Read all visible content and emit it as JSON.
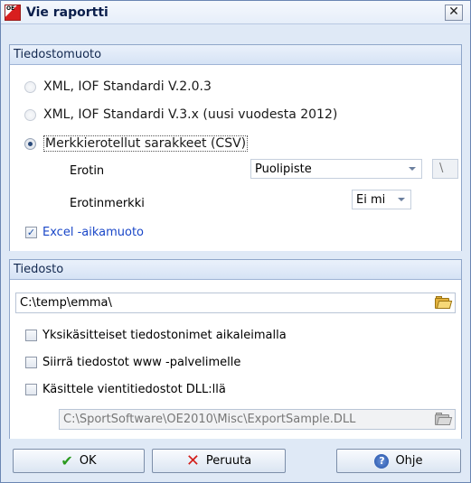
{
  "window": {
    "title": "Vie raportti",
    "app_icon_text": "OE",
    "close_label": "✕"
  },
  "format_group": {
    "header": "Tiedostomuoto",
    "options": [
      {
        "label": "XML, IOF Standardi V.2.0.3",
        "checked": false
      },
      {
        "label": "XML, IOF Standardi V.3.x (uusi vuodesta 2012)",
        "checked": false
      },
      {
        "label": "Merkkierotellut sarakkeet (CSV)",
        "checked": true
      }
    ],
    "separator_label": "Erotin",
    "separator_value": "Puolipiste",
    "separator_char": "\\",
    "text_marker_label": "Erotinmerkki",
    "text_marker_value": "Ei mi",
    "excel_time_label": "Excel -aikamuoto",
    "excel_time_checked": true
  },
  "file_group": {
    "header": "Tiedosto",
    "path": "C:\\temp\\emma\\",
    "unique_names_label": "Yksikäsitteiset tiedostonimet aikaleimalla",
    "upload_label": "Siirrä tiedostot www -palvelimelle",
    "dll_label": "Käsittele vientitiedostot DLL:llä",
    "dll_path": "C:\\SportSoftware\\OE2010\\Misc\\ExportSample.DLL"
  },
  "buttons": {
    "ok": "OK",
    "cancel": "Peruuta",
    "help": "Ohje"
  },
  "icons": {
    "ok": "checkmark-icon",
    "cancel": "x-icon",
    "help": "help-icon",
    "folder": "folder-open-icon"
  }
}
